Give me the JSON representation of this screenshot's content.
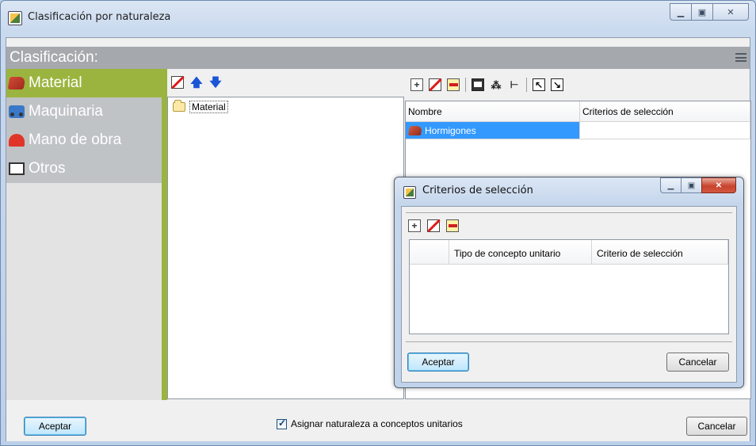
{
  "window": {
    "title": "Clasificación por naturaleza"
  },
  "header": {
    "title": "Clasificación:"
  },
  "categories": [
    {
      "label": "Material",
      "icon": "brick-icon",
      "selected": true
    },
    {
      "label": "Maquinaria",
      "icon": "truck-icon",
      "selected": false
    },
    {
      "label": "Mano de obra",
      "icon": "helmet-icon",
      "selected": false
    },
    {
      "label": "Otros",
      "icon": "square-icon",
      "selected": false
    }
  ],
  "tree": {
    "nodes": [
      {
        "label": "Material"
      }
    ]
  },
  "grid": {
    "columns": [
      "Nombre",
      "Criterios de selección"
    ],
    "rows": [
      {
        "nombre": "Hormigones",
        "criterios": ""
      }
    ]
  },
  "dialog": {
    "title": "Criterios de selección",
    "columns": [
      "",
      "Tipo de concepto unitario",
      "Criterio de selección"
    ],
    "accept_label": "Aceptar",
    "cancel_label": "Cancelar"
  },
  "footer": {
    "accept_label": "Aceptar",
    "checkbox_label": "Asignar naturaleza a conceptos unitarios",
    "checkbox_checked": true,
    "cancel_label": "Cancelar"
  },
  "colors": {
    "category_selected": "#9bb43f",
    "category_default": "#c0c3c6",
    "header_bar": "#a5a9ad",
    "row_selected": "#3399ff"
  }
}
